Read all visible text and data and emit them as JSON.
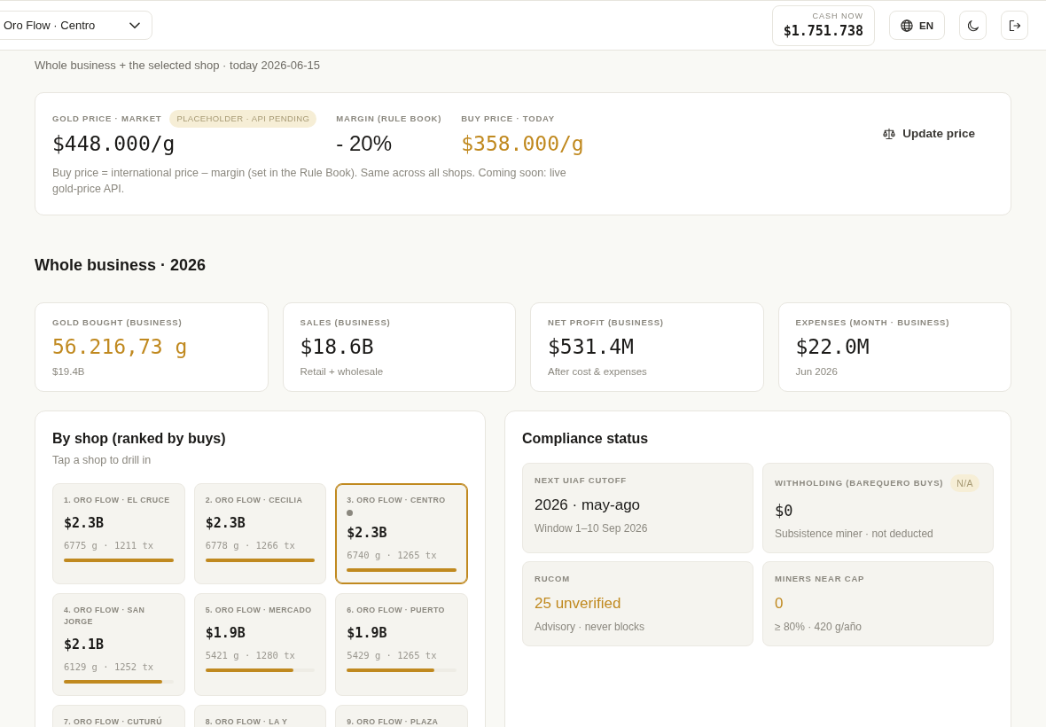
{
  "top_bar": {
    "shop_selector": {
      "value": "Oro Flow · Centro"
    },
    "cash": {
      "label": "CASH NOW",
      "value": "$1.751.738"
    },
    "language": {
      "label": "EN"
    }
  },
  "subtitle": "Whole business + the selected shop · today 2026-06-15",
  "gold_price": {
    "metrics": [
      {
        "label": "GOLD PRICE · MARKET",
        "badge": "PLACEHOLDER · API PENDING",
        "value": "$448.000/g",
        "kind": "money",
        "highlight": false
      },
      {
        "label": "MARGIN (RULE BOOK)",
        "value": "- 20%",
        "kind": "text",
        "highlight": false
      },
      {
        "label": "BUY PRICE · TODAY",
        "value": "$358.000/g",
        "kind": "money",
        "highlight": true
      }
    ],
    "note": "Buy price = international price – margin (set in the Rule Book). Same across all shops. Coming soon: live gold-price API.",
    "action": "Update price"
  },
  "business": {
    "title": "Whole business · 2026",
    "stats": [
      {
        "label": "GOLD BOUGHT (BUSINESS)",
        "value": "56.216,73 g",
        "note": "$19.4B",
        "highlight": true
      },
      {
        "label": "SALES (BUSINESS)",
        "value": "$18.6B",
        "note": "Retail + wholesale",
        "highlight": false
      },
      {
        "label": "NET PROFIT (BUSINESS)",
        "value": "$531.4M",
        "note": "After cost & expenses",
        "highlight": false
      },
      {
        "label": "EXPENSES (MONTH · BUSINESS)",
        "value": "$22.0M",
        "note": "Jun 2026",
        "highlight": false
      }
    ]
  },
  "shops": {
    "title": "By shop (ranked by buys)",
    "hint": "Tap a shop to drill in",
    "items": [
      {
        "name": "1. ORO FLOW · EL CRUCE",
        "value": "$2.3B",
        "meta": "6775 g · 1211 tx",
        "level": 1,
        "selected": false,
        "current": false
      },
      {
        "name": "2. ORO FLOW · CECILIA",
        "value": "$2.3B",
        "meta": "6778 g · 1266 tx",
        "level": 1,
        "selected": false,
        "current": false
      },
      {
        "name": "3. ORO FLOW · CENTRO",
        "value": "$2.3B",
        "meta": "6740 g · 1265 tx",
        "level": 1,
        "selected": true,
        "current": true
      },
      {
        "name": "4. ORO FLOW · SAN JORGE",
        "value": "$2.1B",
        "meta": "6129 g · 1252 tx",
        "level": 0.9,
        "selected": false,
        "current": false
      },
      {
        "name": "5. ORO FLOW · MERCADO",
        "value": "$1.9B",
        "meta": "5421 g · 1280 tx",
        "level": 0.8,
        "selected": false,
        "current": false
      },
      {
        "name": "6. ORO FLOW · PUERTO",
        "value": "$1.9B",
        "meta": "5429 g · 1265 tx",
        "level": 0.8,
        "selected": false,
        "current": false
      },
      {
        "name": "7. ORO FLOW · CUTURÚ",
        "selected": false,
        "current": false
      },
      {
        "name": "8. ORO FLOW · LA Y",
        "selected": false,
        "current": false
      },
      {
        "name": "9. ORO FLOW · PLAZA",
        "selected": false,
        "current": false
      }
    ]
  },
  "compliance": {
    "title": "Compliance status",
    "tiles": [
      {
        "label": "NEXT UIAF CUTOFF",
        "value": "2026 · may-ago",
        "note": "Window 1–10 Sep 2026",
        "kind": "text",
        "highlight": false
      },
      {
        "label": "WITHHOLDING (BAREQUERO BUYS)",
        "badge": "N/A",
        "value": "$0",
        "note": "Subsistence miner · not deducted",
        "kind": "money",
        "highlight": false
      },
      {
        "label": "RUCOM",
        "value": "25 unverified",
        "note": "Advisory · never blocks",
        "kind": "text",
        "highlight": true
      },
      {
        "label": "MINERS NEAR CAP",
        "value": "0",
        "note": "≥ 80% · 420 g/año",
        "kind": "text",
        "highlight": true
      }
    ]
  }
}
